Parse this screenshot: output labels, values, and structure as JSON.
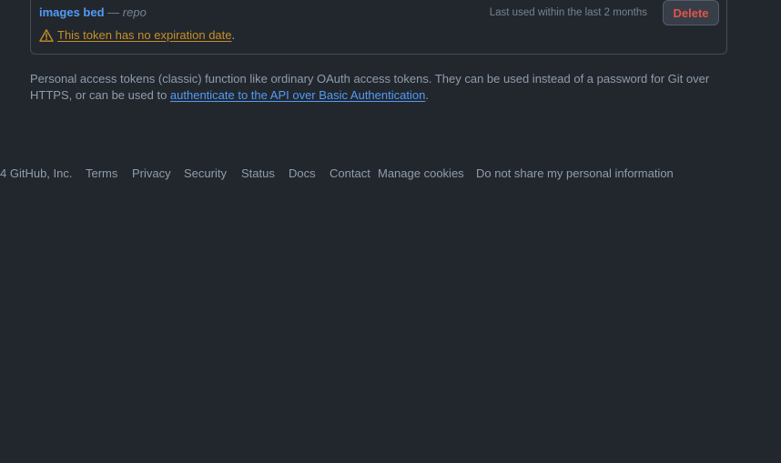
{
  "token": {
    "name": "images bed",
    "separator": "—",
    "scope": "repo",
    "last_used": "Last used within the last 2 months",
    "delete_label": "Delete",
    "warning_text": "This token has no expiration date",
    "warning_period": "."
  },
  "info": {
    "text_before": "Personal access tokens (classic) function like ordinary OAuth access tokens. They can be used instead of a password for Git over HTTPS, or can be used to ",
    "link_text": "authenticate to the API over Basic Authentication",
    "text_after": "."
  },
  "footer": {
    "copyright": "4 GitHub, Inc.",
    "links": [
      "Terms",
      "Privacy",
      "Security",
      "Status",
      "Docs",
      "Contact",
      "Manage cookies",
      "Do not share my personal information"
    ]
  },
  "colors": {
    "background": "#22272e",
    "link": "#539bf5",
    "warning": "#c69026",
    "danger": "#e5534b"
  },
  "icons": {
    "warning": "alert-triangle-icon"
  }
}
